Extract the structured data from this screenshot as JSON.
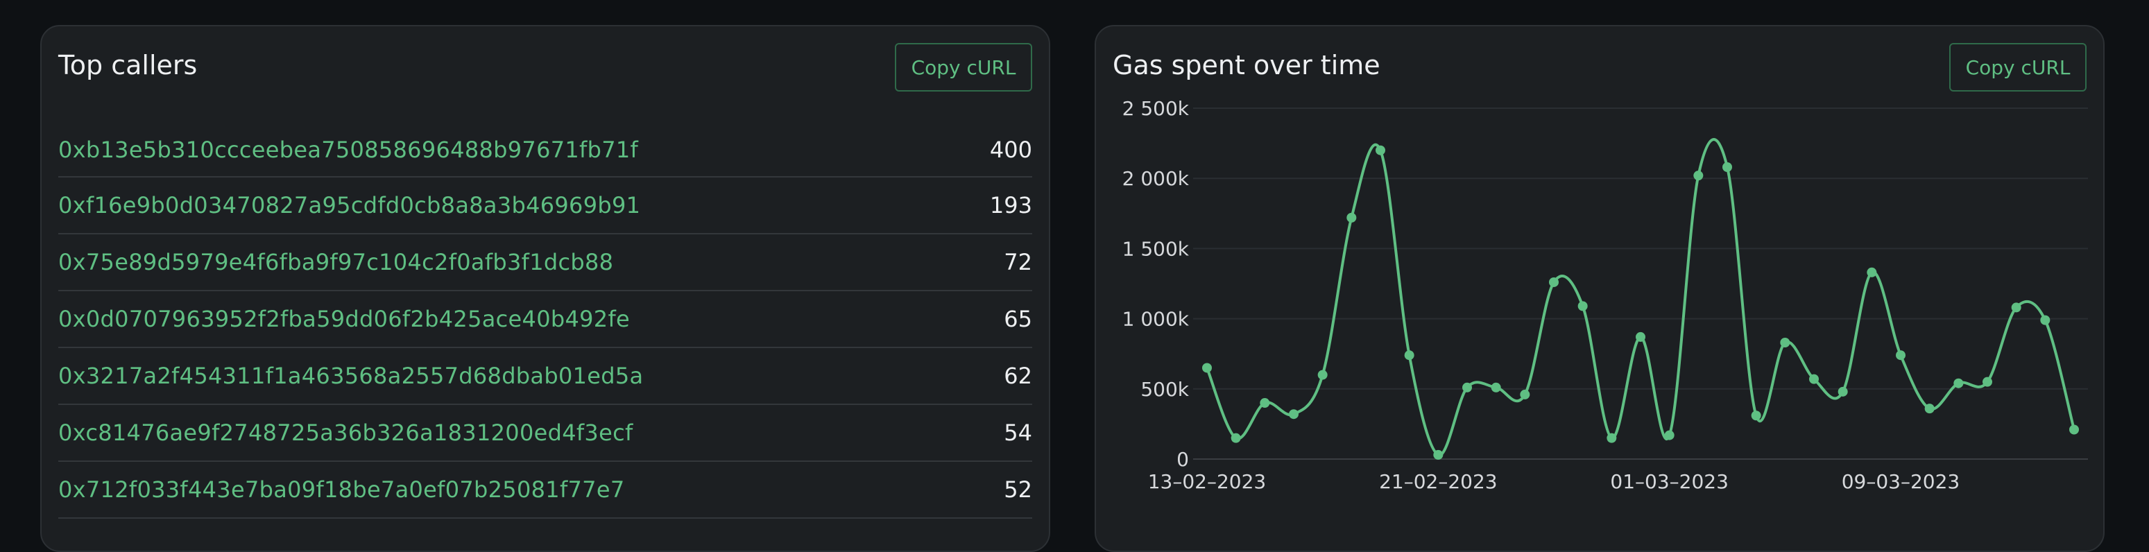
{
  "left_panel": {
    "title": "Top callers",
    "copy_label": "Copy cURL",
    "rows": [
      {
        "address": "0xb13e5b310ccceebea750858696488b97671fb71f",
        "count": "400"
      },
      {
        "address": "0xf16e9b0d03470827a95cdfd0cb8a8a3b46969b91",
        "count": "193"
      },
      {
        "address": "0x75e89d5979e4f6fba9f97c104c2f0afb3f1dcb88",
        "count": "72"
      },
      {
        "address": "0x0d0707963952f2fba59dd06f2b425ace40b492fe",
        "count": "65"
      },
      {
        "address": "0x3217a2f454311f1a463568a2557d68dbab01ed5a",
        "count": "62"
      },
      {
        "address": "0xc81476ae9f2748725a36b326a1831200ed4f3ecf",
        "count": "54"
      },
      {
        "address": "0x712f033f443e7ba09f18be7a0ef07b25081f77e7",
        "count": "52"
      }
    ]
  },
  "right_panel": {
    "title": "Gas spent over time",
    "copy_label": "Copy cURL"
  },
  "chart_data": {
    "type": "line",
    "title": "Gas spent over time",
    "x": [
      "2023-02-13",
      "2023-02-14",
      "2023-02-15",
      "2023-02-16",
      "2023-02-17",
      "2023-02-18",
      "2023-02-19",
      "2023-02-20",
      "2023-02-21",
      "2023-02-22",
      "2023-02-23",
      "2023-02-24",
      "2023-02-25",
      "2023-02-26",
      "2023-02-27",
      "2023-02-28",
      "2023-03-01",
      "2023-03-02",
      "2023-03-03",
      "2023-03-04",
      "2023-03-05",
      "2023-03-06",
      "2023-03-07",
      "2023-03-08",
      "2023-03-09",
      "2023-03-10",
      "2023-03-11",
      "2023-03-12",
      "2023-03-13",
      "2023-03-14",
      "2023-03-15"
    ],
    "series": [
      {
        "values": [
          650,
          150,
          400,
          320,
          600,
          1720,
          2200,
          740,
          30,
          510,
          510,
          460,
          1260,
          1090,
          150,
          870,
          170,
          2020,
          2080,
          310,
          830,
          570,
          480,
          1330,
          740,
          360,
          540,
          550,
          1080,
          990,
          210
        ]
      }
    ],
    "x_tick_labels": [
      "13–02–2023",
      "21–02–2023",
      "01–03–2023",
      "09–03–2023"
    ],
    "y_tick_labels": [
      "0",
      "500k",
      "1 000k",
      "1 500k",
      "2 000k",
      "2 500k"
    ],
    "y_unit_scale": 1000,
    "ylim": [
      0,
      2500000
    ],
    "grid": true,
    "line_color": "#5fbf83"
  }
}
